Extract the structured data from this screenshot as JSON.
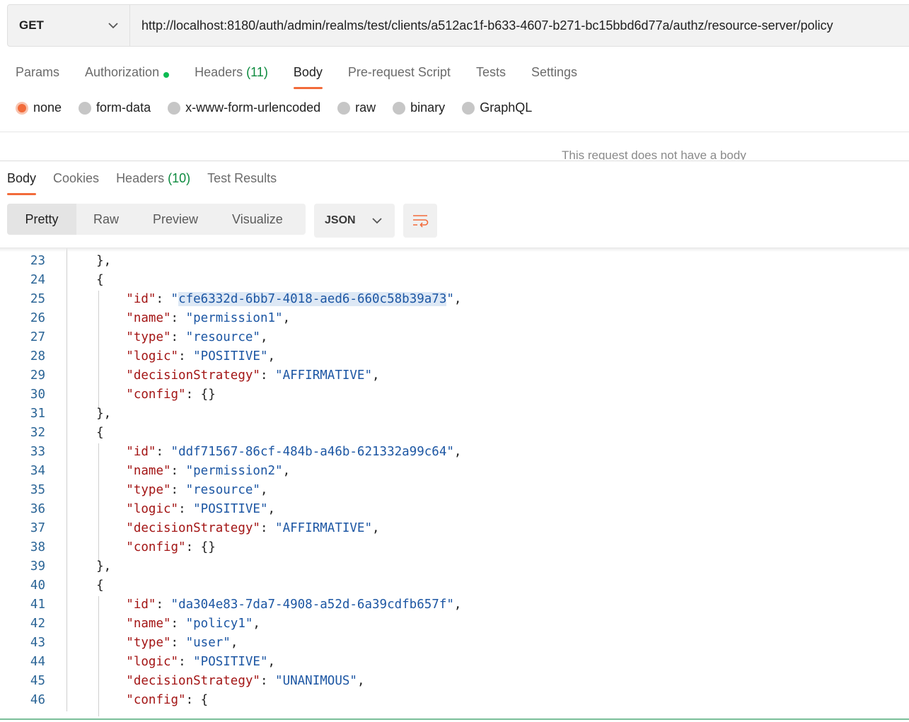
{
  "request": {
    "method": "GET",
    "url": "http://localhost:8180/auth/admin/realms/test/clients/a512ac1f-b633-4607-b271-bc15bbd6d77a/authz/resource-server/policy"
  },
  "request_tabs": [
    {
      "label": "Params"
    },
    {
      "label": "Authorization"
    },
    {
      "label": "Headers",
      "count": "(11)"
    },
    {
      "label": "Body"
    },
    {
      "label": "Pre-request Script"
    },
    {
      "label": "Tests"
    },
    {
      "label": "Settings"
    }
  ],
  "body_types": [
    "none",
    "form-data",
    "x-www-form-urlencoded",
    "raw",
    "binary",
    "GraphQL"
  ],
  "body_selected": "none",
  "no_body_message": "This request does not have a body",
  "response_tabs": [
    {
      "label": "Body"
    },
    {
      "label": "Cookies"
    },
    {
      "label": "Headers",
      "count": "(10)"
    },
    {
      "label": "Test Results"
    }
  ],
  "view_modes": [
    "Pretty",
    "Raw",
    "Preview",
    "Visualize"
  ],
  "format": "JSON",
  "colors": {
    "accent": "#f26b3a",
    "key": "#a31515",
    "string": "#1c56a3",
    "count": "#0c8a3e"
  },
  "code_lines": [
    {
      "n": "23",
      "text": "},"
    },
    {
      "n": "24",
      "text": "{"
    },
    {
      "n": "25",
      "key": "id",
      "value": "cfe6332d-6bb7-4018-aed6-660c58b39a73"
    },
    {
      "n": "26",
      "key": "name",
      "value": "permission1"
    },
    {
      "n": "27",
      "key": "type",
      "value": "resource"
    },
    {
      "n": "28",
      "key": "logic",
      "value": "POSITIVE"
    },
    {
      "n": "29",
      "key": "decisionStrategy",
      "value": "AFFIRMATIVE"
    },
    {
      "n": "30",
      "key": "config",
      "raw": "{}"
    },
    {
      "n": "31",
      "text": "},"
    },
    {
      "n": "32",
      "text": "{"
    },
    {
      "n": "33",
      "key": "id",
      "value": "ddf71567-86cf-484b-a46b-621332a99c64"
    },
    {
      "n": "34",
      "key": "name",
      "value": "permission2"
    },
    {
      "n": "35",
      "key": "type",
      "value": "resource"
    },
    {
      "n": "36",
      "key": "logic",
      "value": "POSITIVE"
    },
    {
      "n": "37",
      "key": "decisionStrategy",
      "value": "AFFIRMATIVE"
    },
    {
      "n": "38",
      "key": "config",
      "raw": "{}"
    },
    {
      "n": "39",
      "text": "},"
    },
    {
      "n": "40",
      "text": "{"
    },
    {
      "n": "41",
      "key": "id",
      "value": "da304e83-7da7-4908-a52d-6a39cdfb657f"
    },
    {
      "n": "42",
      "key": "name",
      "value": "policy1"
    },
    {
      "n": "43",
      "key": "type",
      "value": "user"
    },
    {
      "n": "44",
      "key": "logic",
      "value": "POSITIVE"
    },
    {
      "n": "45",
      "key": "decisionStrategy",
      "value": "UNANIMOUS"
    },
    {
      "n": "46",
      "key": "config",
      "raw": "{"
    }
  ]
}
